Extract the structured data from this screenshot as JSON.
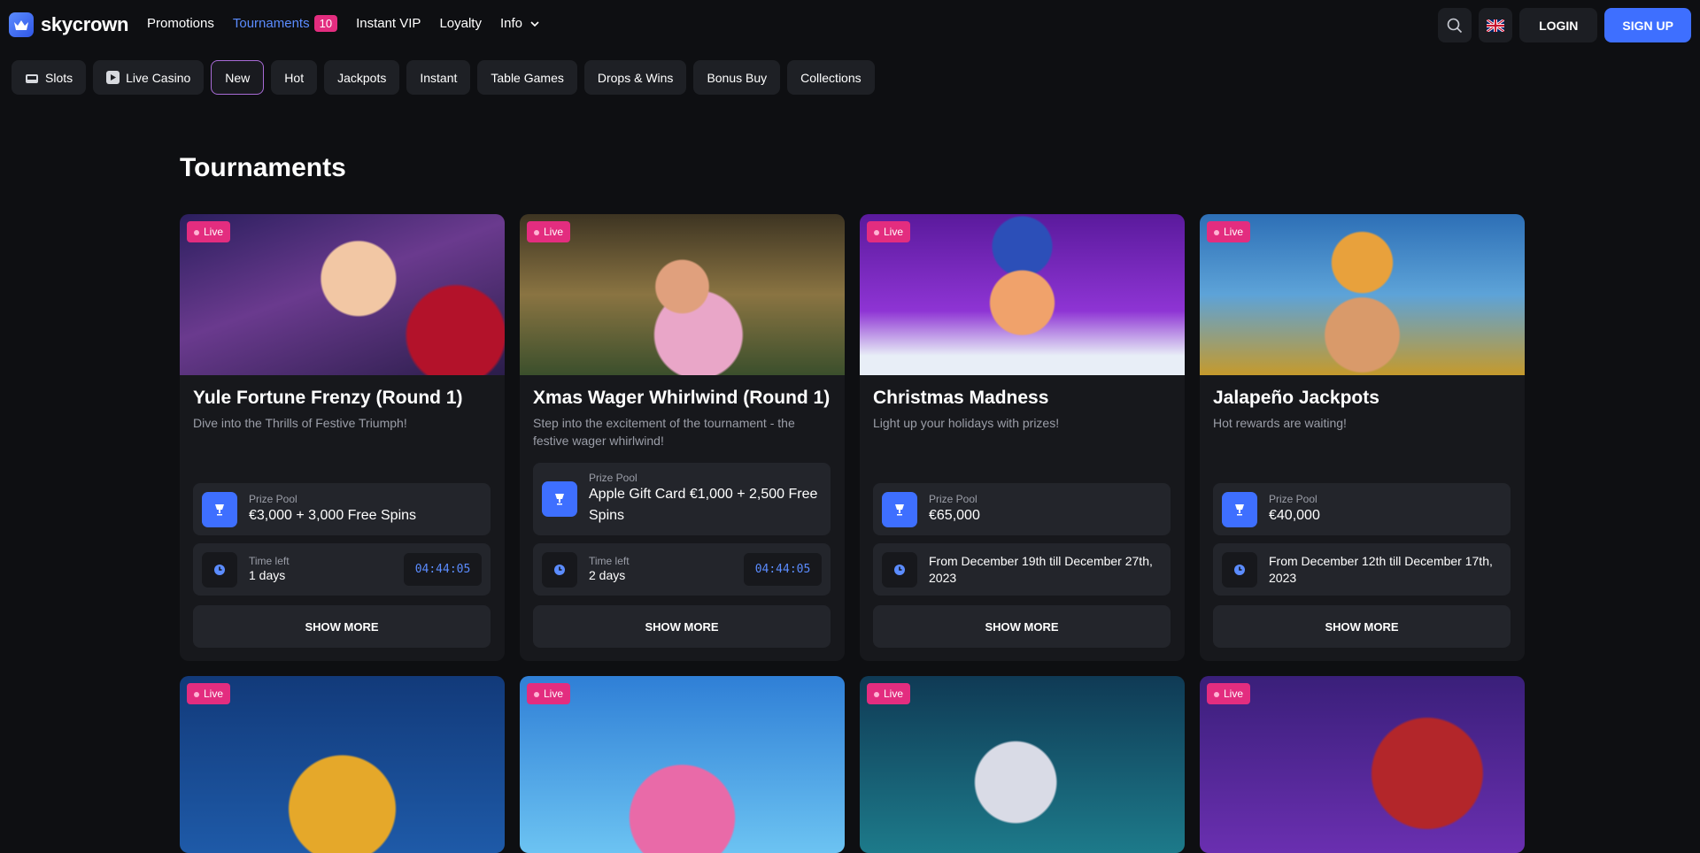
{
  "brand": {
    "name": "skycrown"
  },
  "nav": {
    "promotions": "Promotions",
    "tournaments": "Tournaments",
    "tournaments_count": "10",
    "instant_vip": "Instant VIP",
    "loyalty": "Loyalty",
    "info": "Info"
  },
  "auth": {
    "login": "LOGIN",
    "signup": "SIGN UP"
  },
  "categories": [
    "Slots",
    "Live Casino",
    "New",
    "Hot",
    "Jackpots",
    "Instant",
    "Table Games",
    "Drops & Wins",
    "Bonus Buy",
    "Collections"
  ],
  "selected_category": "New",
  "page_title": "Tournaments",
  "labels": {
    "live": "Live",
    "prize_pool": "Prize Pool",
    "time_left": "Time left",
    "show_more": "SHOW MORE"
  },
  "cards": [
    {
      "title": "Yule Fortune Frenzy (Round 1)",
      "subtitle": "Dive into the Thrills of Festive Triumph!",
      "prize": "€3,000 + 3,000 Free Spins",
      "time_left": "1 days",
      "timer": "04:44:05"
    },
    {
      "title": "Xmas Wager Whirlwind (Round 1)",
      "subtitle": "Step into the excitement of the tournament - the festive wager whirlwind!",
      "prize": "Apple Gift Card €1,000 + 2,500 Free Spins",
      "time_left": "2 days",
      "timer": "04:44:05"
    },
    {
      "title": "Christmas Madness",
      "subtitle": "Light up your holidays with prizes!",
      "prize": "€65,000",
      "dates": "From December 19th till December 27th, 2023"
    },
    {
      "title": "Jalapeño Jackpots",
      "subtitle": "Hot rewards are waiting!",
      "prize": "€40,000",
      "dates": "From December 12th till December 17th, 2023"
    }
  ],
  "colors": {
    "accent_blue": "#3e6fff",
    "live_pink": "#e32d7f",
    "page_bg": "#0e0f12",
    "card_bg": "#17181c"
  },
  "icons": {
    "logo": "crown-icon",
    "search": "search-icon",
    "language": "uk-flag-icon",
    "prize": "trophy-icon",
    "time": "clock-icon"
  }
}
